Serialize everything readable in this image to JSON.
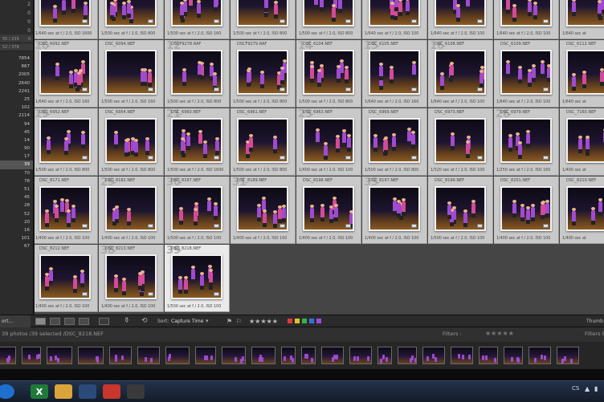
{
  "left_panel": {
    "top_rows": [
      "2",
      "0",
      "0",
      "0"
    ],
    "rows": [
      {
        "l": "55 / 235",
        "r": "0"
      },
      {
        "l": "52 / 378",
        "r": ""
      }
    ],
    "counts": [
      "7854",
      "867",
      "2005",
      "2640",
      "2241",
      "25",
      "102",
      "2114",
      "94",
      "45",
      "14",
      "90",
      "17",
      "39",
      "70",
      "78",
      "51",
      "45",
      "28",
      "52",
      "20",
      "16",
      "101",
      "67"
    ],
    "selected_index": 13,
    "bottom_label": "Sort..."
  },
  "grid": {
    "cells": [
      {
        "idx": "",
        "file": "",
        "info": "1/640 sec at f / 2.0, ISO 1600"
      },
      {
        "idx": "",
        "file": "",
        "info": "1/500 sec at f / 2.0, ISO 800"
      },
      {
        "idx": "",
        "file": "",
        "info": "1/500 sec at f / 2.0, ISO 160"
      },
      {
        "idx": "",
        "file": "",
        "info": "1/500 sec at f / 2.0, ISO 800"
      },
      {
        "idx": "",
        "file": "",
        "info": "1/500 sec at f / 2.0, ISO 800"
      },
      {
        "idx": "",
        "file": "",
        "info": "1/640 sec at f / 2.0, ISO 100"
      },
      {
        "idx": "",
        "file": "",
        "info": "1/640 sec at f / 2.0, ISO 100"
      },
      {
        "idx": "",
        "file": "",
        "info": "1/640 sec at f / 2.0, ISO 100"
      },
      {
        "idx": "",
        "file": "",
        "info": "1/640 sec at"
      },
      {
        "idx": "",
        "file": "DSC_6092.NEF",
        "info": "1/640 sec at f / 2.0, ISO 160"
      },
      {
        "idx": "",
        "file": "DSC_6094.NEF",
        "info": "1/500 sec at f / 2.0, ISO 160"
      },
      {
        "idx": "",
        "file": "DSCF9278.RAF",
        "info": "1/500 sec at f / 2.0, ISO 800"
      },
      {
        "idx": "",
        "file": "DSCF9279.RAF",
        "info": "1/500 sec at f / 2.0, ISO 800"
      },
      {
        "idx": "",
        "file": "DSC_6104.NEF",
        "info": "1/500 sec at f / 2.0, ISO 800"
      },
      {
        "idx": "",
        "file": "DSC_6105.NEF",
        "info": "1/640 sec at f / 2.0, ISO 160"
      },
      {
        "idx": "",
        "file": "DSC_6108.NEF",
        "info": "1/640 sec at f / 2.0, ISO 100"
      },
      {
        "idx": "",
        "file": "DSC_6109.NEF",
        "info": "1/640 sec at f / 2.0, ISO 100"
      },
      {
        "idx": "",
        "file": "DSC_6112.NEF",
        "info": "1/640 sec at"
      },
      {
        "idx": "",
        "file": "DSC_6952.NEF",
        "info": "1/500 sec at f / 2.0, ISO 800"
      },
      {
        "idx": "",
        "file": "DSC_6954.NEF",
        "info": "1/500 sec at f / 2.0, ISO 800"
      },
      {
        "idx": "",
        "file": "DSC_6960.NEF",
        "info": "1/500 sec at f / 2.0, ISO 1600"
      },
      {
        "idx": "",
        "file": "DSC_6961.NEF",
        "info": "1/500 sec at f / 2.0, ISO 800"
      },
      {
        "idx": "",
        "file": "DSC_6963.NEF",
        "info": "1/400 sec at f / 2.0, ISO 100"
      },
      {
        "idx": "",
        "file": "DSC_6969.NEF",
        "info": "1/500 sec at f / 2.0, ISO 800"
      },
      {
        "idx": "",
        "file": "DSC_6973.NEF",
        "info": "1/320 sec at f / 2.0, ISO 100"
      },
      {
        "idx": "",
        "file": "DSC_6979.NEF",
        "info": "1/250 sec at f / 2.0, ISO 160"
      },
      {
        "idx": "",
        "file": "DSC_7160.NEF",
        "info": "1/400 sec at"
      },
      {
        "idx": "",
        "file": "DSC_8171.NEF",
        "info": "1/400 sec at f / 2.0, ISO 100"
      },
      {
        "idx": "",
        "file": "DSC_8182.NEF",
        "info": "1/400 sec at f / 2.0, ISO 100"
      },
      {
        "idx": "",
        "file": "DSC_8187.NEF",
        "info": "1/500 sec at f / 2.0, ISO 100"
      },
      {
        "idx": "",
        "file": "DSC_8189.NEF",
        "info": "1/400 sec at f / 2.0, ISO 100"
      },
      {
        "idx": "",
        "file": "DSC_8196.NEF",
        "info": "1/400 sec at f / 2.0, ISO 100"
      },
      {
        "idx": "",
        "file": "DSC_8197.NEF",
        "info": "1/400 sec at f / 2.0, ISO 100"
      },
      {
        "idx": "",
        "file": "DSC_8199.NEF",
        "info": "1/500 sec at f / 2.0, ISO 100"
      },
      {
        "idx": "",
        "file": "DSC_8201.NEF",
        "info": "1/400 sec at f / 2.0, ISO 100"
      },
      {
        "idx": "",
        "file": "DSC_8210.NEF",
        "info": "1/400 sec at"
      },
      {
        "idx": "",
        "file": "DSC_8212.NEF",
        "info": "1/400 sec at f / 2.0, ISO 100"
      },
      {
        "idx": "",
        "file": "DSC_8213.NEF",
        "info": "1/400 sec at f / 2.0, ISO 100"
      },
      {
        "idx": "",
        "file": "DSC_8218.NEF",
        "info": "1/500 sec at f / 2.0, ISO 100"
      }
    ],
    "cell_numbers": [
      "",
      "",
      "",
      "",
      "",
      "",
      "",
      "",
      "",
      "10",
      "",
      "12",
      "",
      "14",
      "15",
      "16",
      "",
      "",
      "19",
      "",
      "21",
      "",
      "23",
      "",
      "",
      "26",
      "",
      "",
      "29",
      "30",
      "31",
      "",
      "33",
      "",
      "",
      "",
      "",
      "38",
      "39"
    ]
  },
  "toolbar": {
    "left_label": "ort...",
    "sort_label": "Sort:",
    "sort_value": "Capture Time",
    "stars": "★★★★★",
    "right_label": "Thumb",
    "swatch_colors": [
      "#e23a3a",
      "#e3c02a",
      "#33b24a",
      "#3a6ee0",
      "#9a4ae0"
    ]
  },
  "filmbar": {
    "status": "39 photos /39 selected /DSC_8218.NEF",
    "filters_label": "Filters :",
    "filters_off": "Filters Of"
  },
  "taskbar": {
    "items": [
      {
        "icon": "start-orb-icon",
        "label": "",
        "color": "#1f6fd0"
      },
      {
        "icon": "excel-icon",
        "label": "X",
        "color": "#1f7a3a"
      },
      {
        "icon": "folder-icon",
        "label": "",
        "color": "#d9a53a"
      },
      {
        "icon": "app-icon",
        "label": "",
        "color": "#2a4a7a"
      },
      {
        "icon": "chrome-icon",
        "label": "",
        "color": "#c9362c"
      },
      {
        "icon": "lightroom-icon",
        "label": "",
        "color": "#3a3a3a"
      }
    ],
    "tray_lang": "CS"
  }
}
